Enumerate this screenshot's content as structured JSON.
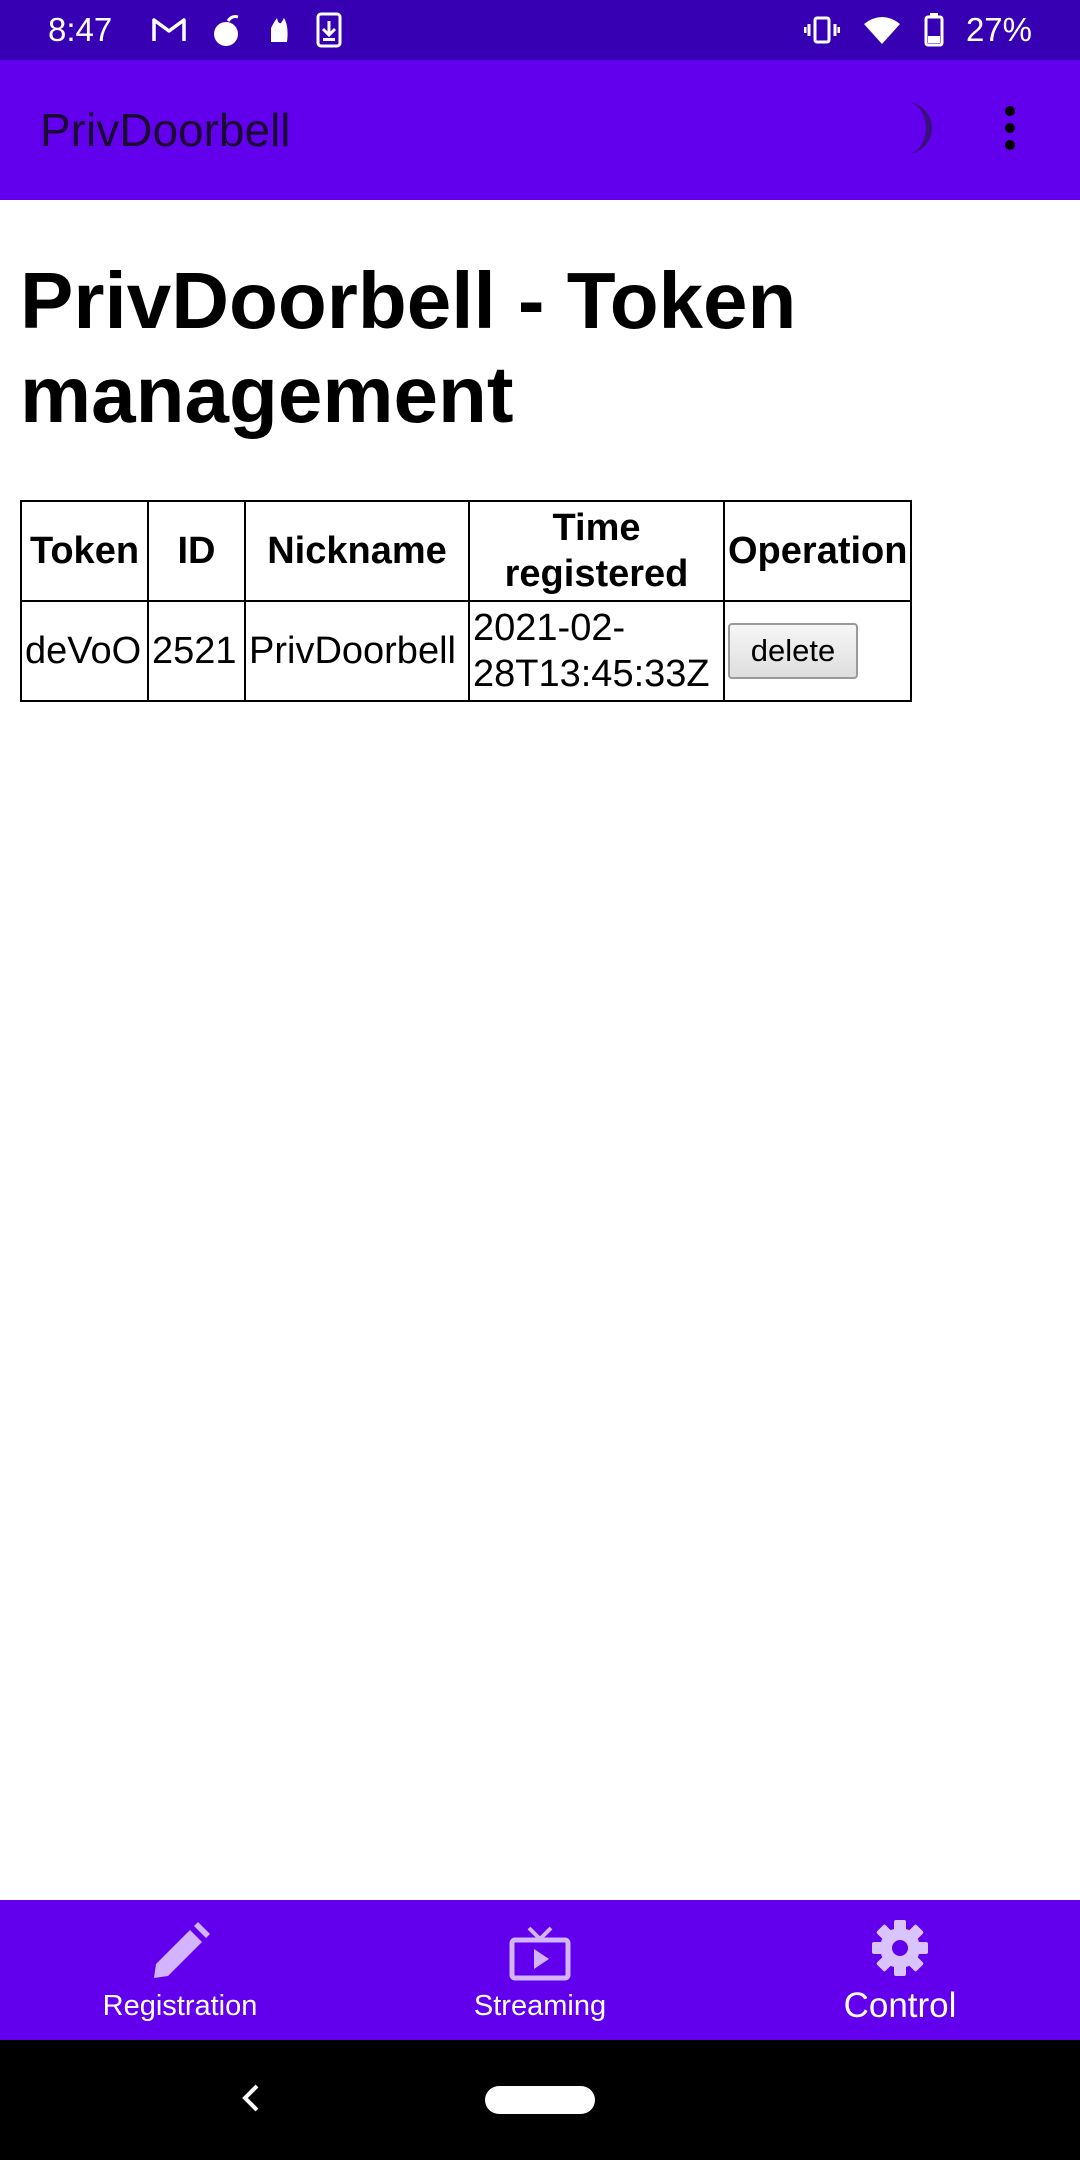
{
  "status_bar": {
    "time": "8:47",
    "left_icons": [
      "gmail-icon",
      "bomb-icon",
      "flame-icon",
      "download-icon"
    ],
    "right_icons": [
      "vibrate-icon",
      "wifi-icon",
      "battery-icon"
    ],
    "battery": "27%"
  },
  "app_bar": {
    "title": "PrivDoorbell",
    "actions": [
      "dark-mode-icon",
      "more-vert-icon"
    ]
  },
  "page": {
    "heading": "PrivDoorbell - Token management"
  },
  "table": {
    "headers": {
      "token": "Token",
      "id": "ID",
      "nickname": "Nickname",
      "time": "Time registered",
      "operation": "Operation"
    },
    "rows": [
      {
        "token": "deVoO",
        "id": "2521",
        "nickname": "PrivDoorbell",
        "time_registered": "2021-02-28T13:45:33Z",
        "operation": "delete"
      }
    ]
  },
  "bottom_nav": {
    "items": [
      {
        "label": "Registration",
        "icon": "pencil-icon"
      },
      {
        "label": "Streaming",
        "icon": "tv-play-icon"
      },
      {
        "label": "Control",
        "icon": "gear-icon"
      }
    ],
    "active": "Control"
  },
  "colors": {
    "status_bar": "#3700b3",
    "primary": "#6200ee",
    "nav_icon_inactive": "#d2b4ff",
    "nav_icon_active": "#d9c4ff"
  }
}
